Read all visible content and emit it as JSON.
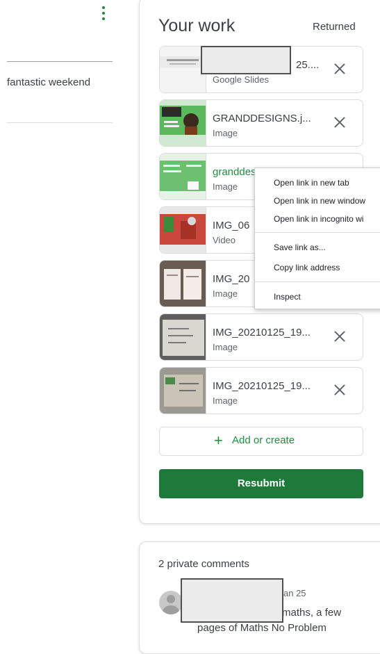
{
  "left": {
    "text": "fantastic weekend"
  },
  "work": {
    "title": "Your work",
    "status": "Returned",
    "attachments": [
      {
        "name": "25....",
        "type": "Google Slides"
      },
      {
        "name": "GRANDDESIGNS.j...",
        "type": "Image"
      },
      {
        "name": "granddesigns2.jpg",
        "type": "Image"
      },
      {
        "name": "IMG_06",
        "type": "Video"
      },
      {
        "name": "IMG_20",
        "type": "Image"
      },
      {
        "name": "IMG_20210125_19...",
        "type": "Image"
      },
      {
        "name": "IMG_20210125_19...",
        "type": "Image"
      }
    ],
    "add_label": "Add or create",
    "add_icon": "+",
    "resubmit_label": "Resubmit"
  },
  "context_menu": {
    "items": [
      "Open link in new tab",
      "Open link in new window",
      "Open link in incognito wi",
      "Save link as...",
      "Copy link address",
      "Inspect"
    ]
  },
  "comments": {
    "title": "2 private comments",
    "date": "an 25",
    "line1": "maths, a few",
    "line2": "pages of Maths No Problem"
  },
  "colors": {
    "accent": "#1e8e3e",
    "button": "#1e7a3a"
  }
}
